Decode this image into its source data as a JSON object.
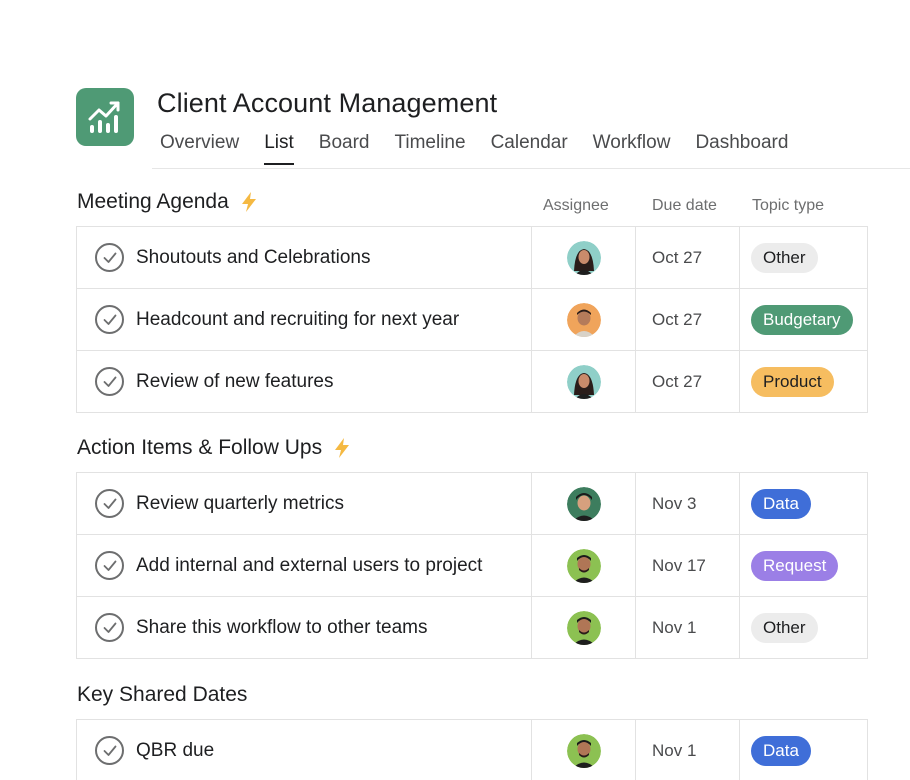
{
  "project": {
    "title": "Client Account Management",
    "icon": "trending-chart-icon"
  },
  "tabs": [
    {
      "label": "Overview",
      "active": false
    },
    {
      "label": "List",
      "active": true
    },
    {
      "label": "Board",
      "active": false
    },
    {
      "label": "Timeline",
      "active": false
    },
    {
      "label": "Calendar",
      "active": false
    },
    {
      "label": "Workflow",
      "active": false
    },
    {
      "label": "Dashboard",
      "active": false
    }
  ],
  "columns": {
    "assignee": "Assignee",
    "due_date": "Due date",
    "topic_type": "Topic type"
  },
  "sections": [
    {
      "title": "Meeting Agenda",
      "has_bolt": true,
      "rows": [
        {
          "task": "Shoutouts and Celebrations",
          "assignee": "avatar-woman-teal",
          "date": "Oct 27",
          "topic": "Other",
          "topic_style": "other"
        },
        {
          "task": "Headcount and recruiting for next year",
          "assignee": "avatar-man-orange",
          "date": "Oct 27",
          "topic": "Budgetary",
          "topic_style": "budgetary"
        },
        {
          "task": "Review of new features",
          "assignee": "avatar-woman-teal",
          "date": "Oct 27",
          "topic": "Product",
          "topic_style": "product"
        }
      ]
    },
    {
      "title": "Action Items & Follow Ups",
      "has_bolt": true,
      "rows": [
        {
          "task": "Review quarterly metrics",
          "assignee": "avatar-man-green",
          "date": "Nov 3",
          "topic": "Data",
          "topic_style": "data"
        },
        {
          "task": "Add internal and external users to project",
          "assignee": "avatar-man-lime",
          "date": "Nov 17",
          "topic": "Request",
          "topic_style": "request"
        },
        {
          "task": "Share this workflow to other teams",
          "assignee": "avatar-man-lime",
          "date": "Nov 1",
          "topic": "Other",
          "topic_style": "other"
        }
      ]
    },
    {
      "title": "Key Shared Dates",
      "has_bolt": false,
      "rows": [
        {
          "task": "QBR due",
          "assignee": "avatar-man-lime",
          "date": "Nov 1",
          "topic": "Data",
          "topic_style": "data"
        }
      ]
    }
  ],
  "colors": {
    "brand_green": "#4f9a75",
    "product_orange": "#f6bd60",
    "data_blue": "#3f6ed8",
    "request_purple": "#9b7fe6",
    "other_gray": "#ececec",
    "bolt_yellow": "#f5b942"
  }
}
